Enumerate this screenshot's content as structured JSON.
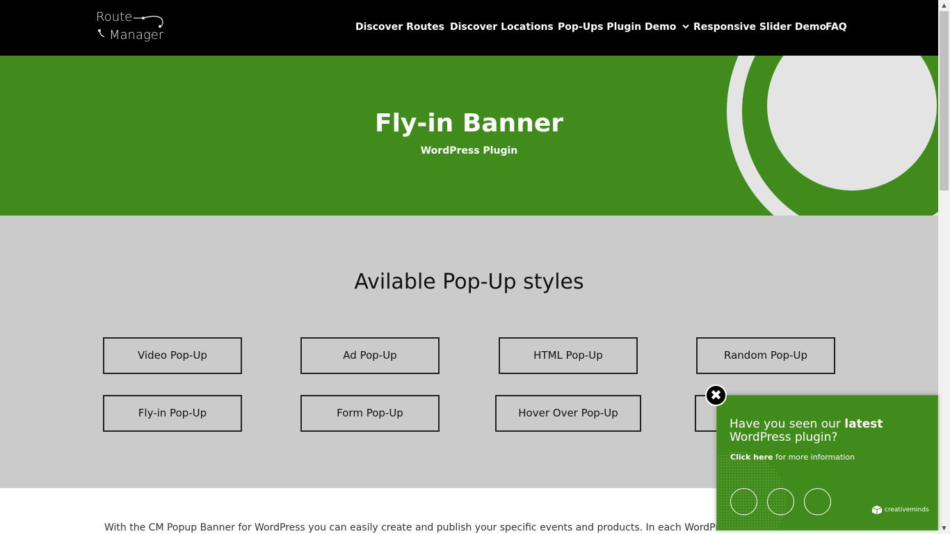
{
  "logo": {
    "line1": "Route",
    "line2": "Manager"
  },
  "nav": {
    "items": [
      {
        "label": "Discover Routes"
      },
      {
        "label": "Discover Locations"
      },
      {
        "label": "Pop-Ups Plugin Demo",
        "chevron": "⌄"
      },
      {
        "label": "Responsive Slider Demo"
      },
      {
        "label": "FAQ"
      }
    ]
  },
  "hero": {
    "title": "Fly-in Banner",
    "subtitle": "WordPress Plugin"
  },
  "styles": {
    "heading": "Avilable Pop-Up styles",
    "buttons": [
      "Video Pop-Up",
      "Ad Pop-Up",
      "HTML Pop-Up",
      "Random Pop-Up",
      "Fly-in Pop-Up",
      "Form Pop-Up",
      "Hover Over Pop-Up",
      ""
    ]
  },
  "body": {
    "text": "With the CM Popup Banner for WordPress you can easily create and publish your specific events and products. In each WordPress page or post"
  },
  "popup": {
    "headline_start": "Have you seen our ",
    "headline_bold": "latest",
    "headline_end": " WordPress plugin?",
    "link_label": "Click here",
    "info_rest": " for more information",
    "brand": "creativeminds",
    "close_symbol": "✖"
  },
  "colors": {
    "brand_green": "#418b1c",
    "header_bg": "#000000",
    "section_gray": "#cbcbcb"
  },
  "icons": {
    "nav_chevron": "chevron-down-icon",
    "close": "close-icon",
    "brand": "cube-logo-icon"
  }
}
